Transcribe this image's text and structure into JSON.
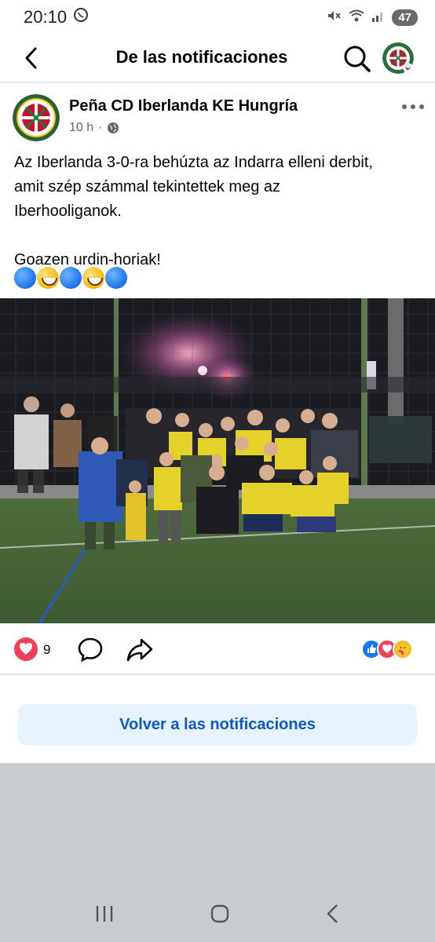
{
  "status_bar": {
    "time": "20:10",
    "battery": "47"
  },
  "header": {
    "title": "De las notificaciones",
    "icons": [
      "arrow-left-icon",
      "search-icon",
      "profile-avatar"
    ]
  },
  "post": {
    "page_name": "Peña CD Iberlanda KE Hungría",
    "time_ago": "10 h",
    "privacy_icon": "globe-icon",
    "text": "Az Iberlanda 3-0-ra behúzta az Indarra elleni derbit,\namit szép számmal tekintettek meg az\nIberhooliganok.\n\nGoazen urdin-horiak!",
    "emojis": [
      "blue-circle",
      "grinning-face",
      "blue-circle",
      "grinning-face",
      "blue-circle"
    ],
    "photo_alt": "Team photo on football pitch at night with flares",
    "reaction_count": "9",
    "reaction_types": [
      "like",
      "love",
      "care"
    ]
  },
  "footer": {
    "back_button_label": "Volver a las notificaciones"
  },
  "colors": {
    "accent": "#0f57c6",
    "button_bg": "#e7f3ff",
    "love_red": "#f33e58",
    "nav_bg": "#c9ccd1"
  }
}
